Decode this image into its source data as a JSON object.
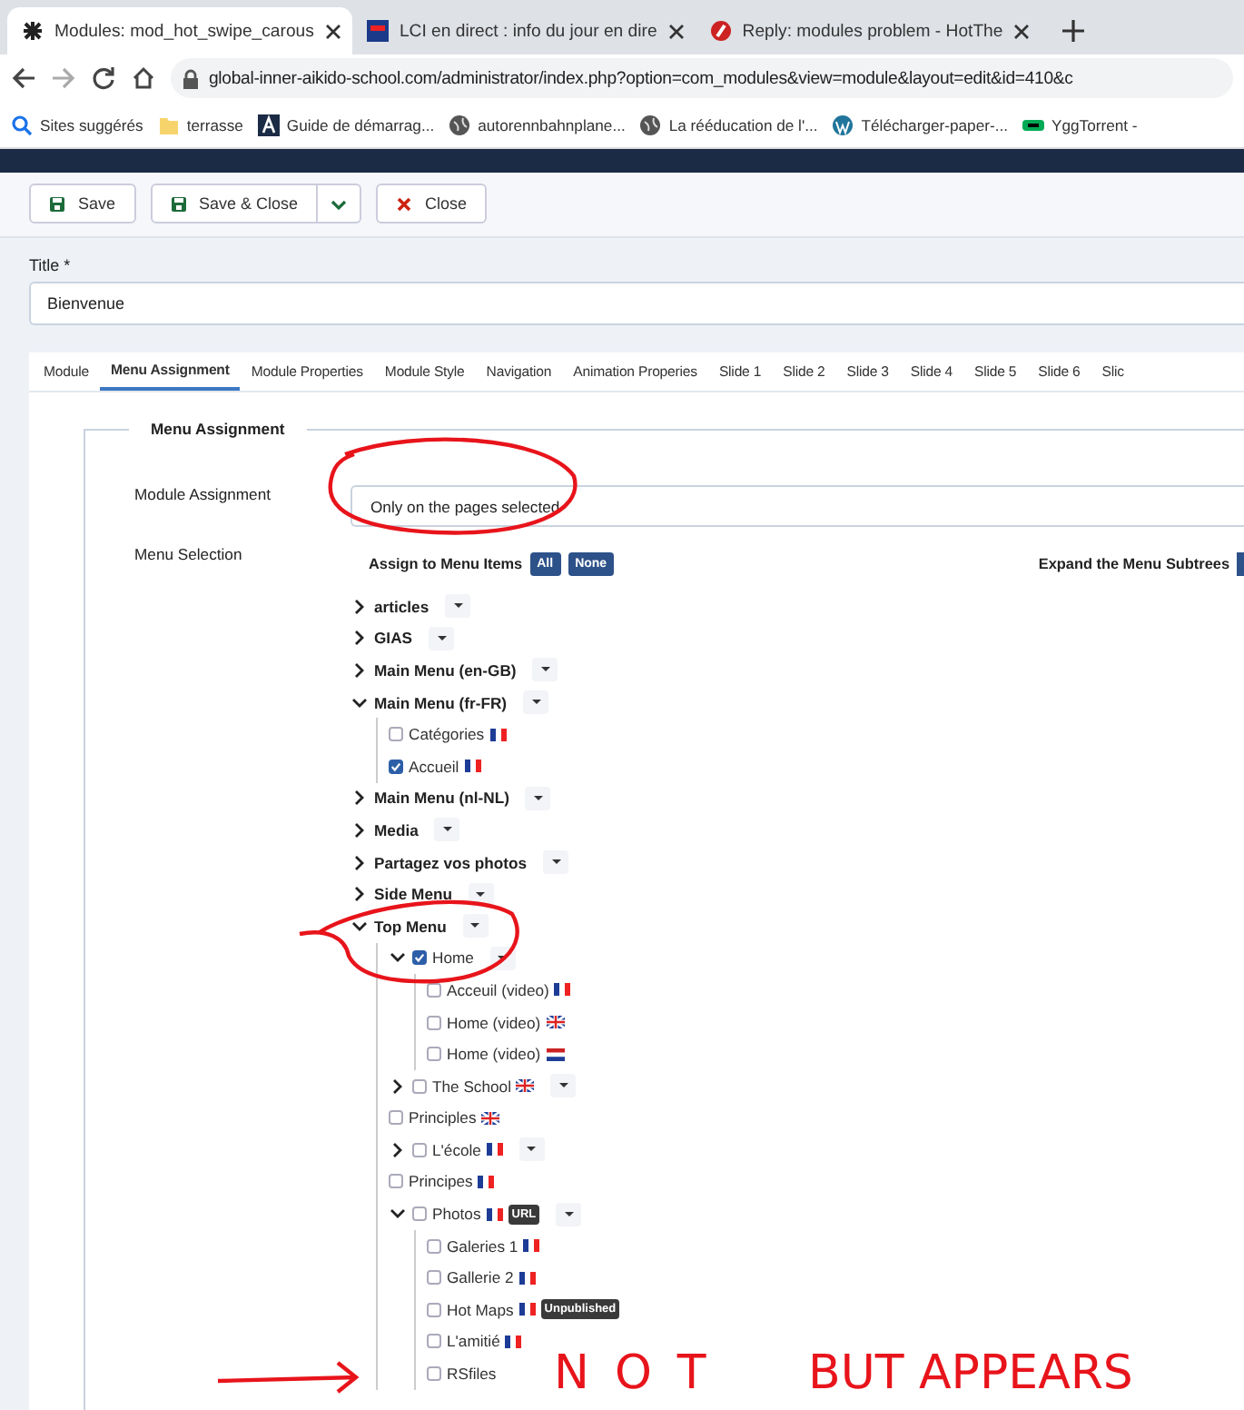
{
  "browser": {
    "tabs": [
      {
        "title": "Modules: mod_hot_swipe_carous",
        "selected": true
      },
      {
        "title": "LCI en direct : info du jour en dire",
        "selected": false
      },
      {
        "title": "Reply: modules problem - HotThe",
        "selected": false
      }
    ],
    "url": "global-inner-aikido-school.com/administrator/index.php?option=com_modules&view=module&layout=edit&id=410&c",
    "bookmarks": [
      "Sites suggérés",
      "terrasse",
      "Guide de démarrag...",
      "autorennbahnplane...",
      "La rééducation de l'...",
      "Télécharger-paper-...",
      "YggTorrent -"
    ]
  },
  "toolbar": {
    "buttons": [
      {
        "label": "Save",
        "kind": "save"
      },
      {
        "label": "Save & Close",
        "kind": "save-split"
      },
      {
        "label": "Close",
        "kind": "close"
      }
    ]
  },
  "title_field": {
    "label": "Title *",
    "value": "Bienvenue"
  },
  "tabs": [
    {
      "label": "Module",
      "selected": false
    },
    {
      "label": "Menu Assignment",
      "selected": true
    },
    {
      "label": "Module Properties",
      "selected": false
    },
    {
      "label": "Module Style",
      "selected": false
    },
    {
      "label": "Navigation",
      "selected": false
    },
    {
      "label": "Animation Properies",
      "selected": false
    },
    {
      "label": "Slide 1",
      "selected": false
    },
    {
      "label": "Slide 2",
      "selected": false
    },
    {
      "label": "Slide 3",
      "selected": false
    },
    {
      "label": "Slide 4",
      "selected": false
    },
    {
      "label": "Slide 5",
      "selected": false
    },
    {
      "label": "Slide 6",
      "selected": false
    },
    {
      "label": "Slic",
      "selected": false
    }
  ],
  "menu_assignment": {
    "legend": "Menu Assignment",
    "module_assignment_label": "Module Assignment",
    "module_assignment_value": "Only on the pages selected",
    "menu_selection_label": "Menu Selection",
    "assign_label": "Assign to Menu Items",
    "assign_buttons": [
      "All",
      "None"
    ],
    "expand_label": "Expand the Menu Subtrees",
    "tree": [
      {
        "kind": "menu",
        "label": "articles",
        "expanded": false
      },
      {
        "kind": "menu",
        "label": "GIAS",
        "expanded": false
      },
      {
        "kind": "menu",
        "label": "Main Menu (en-GB)",
        "expanded": false
      },
      {
        "kind": "menu",
        "label": "Main Menu (fr-FR)",
        "expanded": true,
        "children": [
          {
            "kind": "item",
            "label": "Catégories",
            "checked": false,
            "flag": {
              "kind": "fr"
            }
          },
          {
            "kind": "item",
            "label": "Accueil",
            "checked": true,
            "flag": {
              "kind": "fr"
            }
          }
        ]
      },
      {
        "kind": "menu",
        "label": "Main Menu (nl-NL)",
        "expanded": false
      },
      {
        "kind": "menu",
        "label": "Media",
        "expanded": false
      },
      {
        "kind": "menu",
        "label": "Partagez vos photos",
        "expanded": false
      },
      {
        "kind": "menu",
        "label": "Side Menu",
        "expanded": false
      },
      {
        "kind": "menu",
        "label": "Top Menu",
        "expanded": true,
        "children": [
          {
            "kind": "item",
            "label": "Home",
            "checked": true,
            "expanded": true,
            "children": [
              {
                "kind": "item",
                "label": "Acceuil (video)",
                "checked": false,
                "flag": {
                  "kind": "fr"
                }
              },
              {
                "kind": "item",
                "label": "Home (video)",
                "checked": false,
                "flag": {
                  "kind": "gb"
                }
              },
              {
                "kind": "item",
                "label": "Home (video)",
                "checked": false,
                "flag": {
                  "kind": "nl"
                }
              }
            ]
          },
          {
            "kind": "item",
            "label": "The School",
            "checked": false,
            "flag": {
              "kind": "gb"
            },
            "expanded": false
          },
          {
            "kind": "item",
            "label": "Principles",
            "checked": false,
            "flag": {
              "kind": "gb"
            }
          },
          {
            "kind": "item",
            "label": "L'école",
            "checked": false,
            "flag": {
              "kind": "fr"
            },
            "expanded": false
          },
          {
            "kind": "item",
            "label": "Principes",
            "checked": false,
            "flag": {
              "kind": "fr"
            }
          },
          {
            "kind": "item",
            "label": "Photos",
            "checked": false,
            "flag": {
              "kind": "fr"
            },
            "badge": "URL",
            "expanded": true,
            "children": [
              {
                "kind": "item",
                "label": "Galeries 1",
                "checked": false,
                "flag": {
                  "kind": "fr"
                }
              },
              {
                "kind": "item",
                "label": "Gallerie 2",
                "checked": false,
                "flag": {
                  "kind": "fr"
                }
              },
              {
                "kind": "item",
                "label": "Hot Maps",
                "checked": false,
                "flag": {
                  "kind": "fr"
                },
                "badge": "Unpublished"
              },
              {
                "kind": "item",
                "label": "L'amitié",
                "checked": false,
                "flag": {
                  "kind": "fr"
                }
              },
              {
                "kind": "item",
                "label": "RSfiles",
                "checked": false
              }
            ]
          }
        ]
      }
    ]
  },
  "annotations": [
    {
      "kind": "ellipse"
    },
    {
      "kind": "ellipse"
    },
    {
      "kind": "arrow"
    },
    {
      "kind": "text",
      "text": "NOT"
    },
    {
      "kind": "text",
      "text": "BUT APPEARS"
    }
  ]
}
